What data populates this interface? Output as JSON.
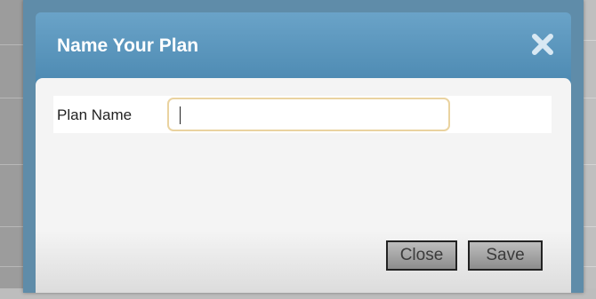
{
  "dialog": {
    "title": "Name Your Plan",
    "close_icon": "close-x-icon"
  },
  "form": {
    "plan_name_label": "Plan Name",
    "plan_name_value": ""
  },
  "buttons": {
    "close_label": "Close",
    "save_label": "Save"
  },
  "colors": {
    "title_bar": "#5a96c0",
    "input_focus_border": "#ead3a0",
    "button_face": "#a7a7a7"
  }
}
